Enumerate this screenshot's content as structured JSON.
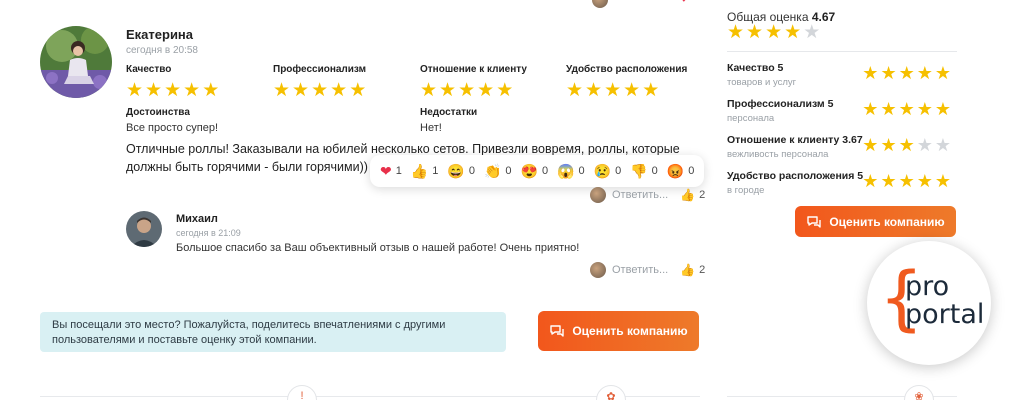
{
  "review": {
    "author": "Екатерина",
    "time": "сегодня в 20:58",
    "criteria": [
      {
        "label": "Качество",
        "rating": 5
      },
      {
        "label": "Профессионализм",
        "rating": 5
      },
      {
        "label": "Отношение к клиенту",
        "rating": 5
      },
      {
        "label": "Удобство расположения",
        "rating": 5
      }
    ],
    "pros_label": "Достоинства",
    "pros": "Все просто супер!",
    "cons_label": "Недостатки",
    "cons": "Нет!",
    "text": "Отличные роллы! Заказывали на юбилей несколько сетов. Привезли вовремя, роллы, которые должны быть горячими - были горячими)) Рекомендую!",
    "reactions": [
      {
        "icon": "heart-icon",
        "glyph": "❤",
        "count": "1"
      },
      {
        "icon": "thumbs-up-icon",
        "glyph": "👍",
        "count": "1"
      },
      {
        "icon": "grin-icon",
        "glyph": "😄",
        "count": "0"
      },
      {
        "icon": "clap-icon",
        "glyph": "👏",
        "count": "0"
      },
      {
        "icon": "heart-eyes-icon",
        "glyph": "😍",
        "count": "0"
      },
      {
        "icon": "shocked-icon",
        "glyph": "😱",
        "count": "0"
      },
      {
        "icon": "crying-icon",
        "glyph": "😢",
        "count": "0"
      },
      {
        "icon": "thumbs-down-icon",
        "glyph": "👎",
        "count": "0"
      },
      {
        "icon": "angry-icon",
        "glyph": "😡",
        "count": "0"
      }
    ],
    "reply_label": "Ответить...",
    "likes": "2"
  },
  "reply": {
    "author": "Михаил",
    "time": "сегодня в 21:09",
    "text": "Большое спасибо за Ваш объективный отзыв о нашей работе! Очень приятно!",
    "reply_label": "Ответить...",
    "likes": "2"
  },
  "prompt": {
    "text": "Вы посещали это место? Пожалуйста, поделитесь впечатлениями с другими пользователями и поставьте оценку этой компании.",
    "button": "Оценить компанию"
  },
  "sidebar": {
    "overall_label": "Общая оценка",
    "overall_value": "4.67",
    "overall_rating": 4,
    "rows": [
      {
        "title": "Качество 5",
        "sub": "товаров и услуг",
        "rating": 5
      },
      {
        "title": "Профессионализм 5",
        "sub": "персонала",
        "rating": 5
      },
      {
        "title": "Отношение к клиенту 3.67",
        "sub": "вежливость персонала",
        "rating": 3
      },
      {
        "title": "Удобство расположения 5",
        "sub": "в городе",
        "rating": 5
      }
    ],
    "button": "Оценить компанию"
  },
  "logo": {
    "line1": "pro",
    "line2": "portal"
  },
  "colors": {
    "accent": "#f05a1f",
    "star": "#f6c000",
    "prompt_bg": "#d9f0f3"
  }
}
